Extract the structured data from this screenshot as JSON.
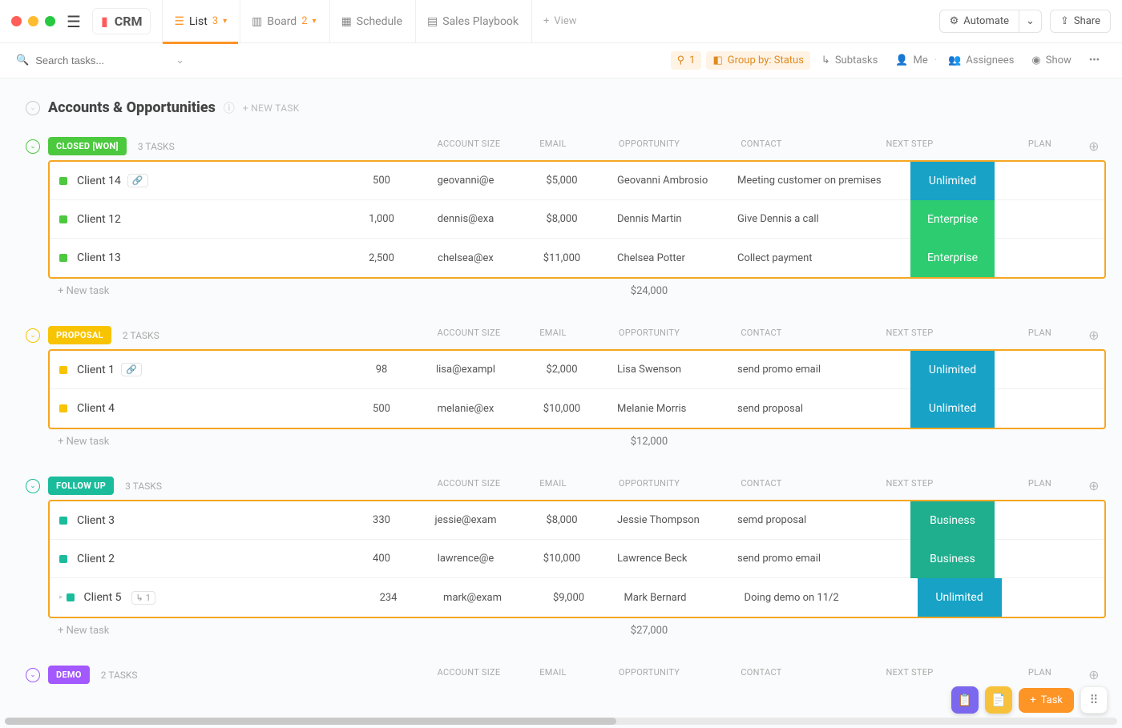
{
  "workspace": "CRM",
  "views": {
    "list": {
      "label": "List",
      "count": "3"
    },
    "board": {
      "label": "Board",
      "count": "2"
    },
    "schedule": {
      "label": "Schedule"
    },
    "playbook": {
      "label": "Sales Playbook"
    },
    "add": {
      "label": "View"
    }
  },
  "topright": {
    "automate": "Automate",
    "share": "Share"
  },
  "filterbar": {
    "search_placeholder": "Search tasks...",
    "filter_count": "1",
    "groupby": "Group by: Status",
    "subtasks": "Subtasks",
    "me": "Me",
    "assignees": "Assignees",
    "show": "Show"
  },
  "page": {
    "title": "Accounts & Opportunities",
    "new_task": "+ NEW TASK"
  },
  "columns": {
    "acct": "ACCOUNT SIZE",
    "email": "EMAIL",
    "opp": "OPPORTUNITY",
    "contact": "CONTACT",
    "step": "NEXT STEP",
    "plan": "PLAN"
  },
  "newtask": "+ New task",
  "plans": {
    "Unlimited": {
      "bg": "#17a2c6"
    },
    "Enterprise": {
      "bg": "#2ecc71"
    },
    "Business": {
      "bg": "#1fae8e"
    }
  },
  "groups": [
    {
      "status": "CLOSED [WON]",
      "color": "#4cc93f",
      "sq": "#4cc93f",
      "task_count": "3 TASKS",
      "sum": "$24,000",
      "rows": [
        {
          "client": "Client 14",
          "link": true,
          "acct": "500",
          "email": "geovanni@e",
          "opp": "$5,000",
          "contact": "Geovanni Ambrosio",
          "step": "Meeting customer on premises",
          "plan": "Unlimited"
        },
        {
          "client": "Client 12",
          "acct": "1,000",
          "email": "dennis@exa",
          "opp": "$8,000",
          "contact": "Dennis Martin",
          "step": "Give Dennis a call",
          "plan": "Enterprise"
        },
        {
          "client": "Client 13",
          "acct": "2,500",
          "email": "chelsea@ex",
          "opp": "$11,000",
          "contact": "Chelsea Potter",
          "step": "Collect payment",
          "plan": "Enterprise"
        }
      ]
    },
    {
      "status": "PROPOSAL",
      "color": "#f8c300",
      "sq": "#f8c300",
      "task_count": "2 TASKS",
      "sum": "$12,000",
      "rows": [
        {
          "client": "Client 1",
          "link": true,
          "acct": "98",
          "email": "lisa@exampl",
          "opp": "$2,000",
          "contact": "Lisa Swenson",
          "step": "send promo email",
          "plan": "Unlimited"
        },
        {
          "client": "Client 4",
          "acct": "500",
          "email": "melanie@ex",
          "opp": "$10,000",
          "contact": "Melanie Morris",
          "step": "send proposal",
          "plan": "Unlimited"
        }
      ]
    },
    {
      "status": "FOLLOW UP",
      "color": "#1abc9c",
      "sq": "#1abc9c",
      "task_count": "3 TASKS",
      "sum": "$27,000",
      "rows": [
        {
          "client": "Client 3",
          "acct": "330",
          "email": "jessie@exam",
          "opp": "$8,000",
          "contact": "Jessie Thompson",
          "step": "semd proposal",
          "plan": "Business"
        },
        {
          "client": "Client 2",
          "acct": "400",
          "email": "lawrence@e",
          "opp": "$10,000",
          "contact": "Lawrence Beck",
          "step": "send promo email",
          "plan": "Business"
        },
        {
          "client": "Client 5",
          "sub": "1",
          "tri": true,
          "acct": "234",
          "email": "mark@exam",
          "opp": "$9,000",
          "contact": "Mark Bernard",
          "step": "Doing demo on 11/2",
          "plan": "Unlimited"
        }
      ]
    },
    {
      "status": "DEMO",
      "color": "#a259ff",
      "sq": "#a259ff",
      "task_count": "2 TASKS",
      "sum": "",
      "rows": []
    }
  ],
  "float": {
    "task": "Task"
  }
}
